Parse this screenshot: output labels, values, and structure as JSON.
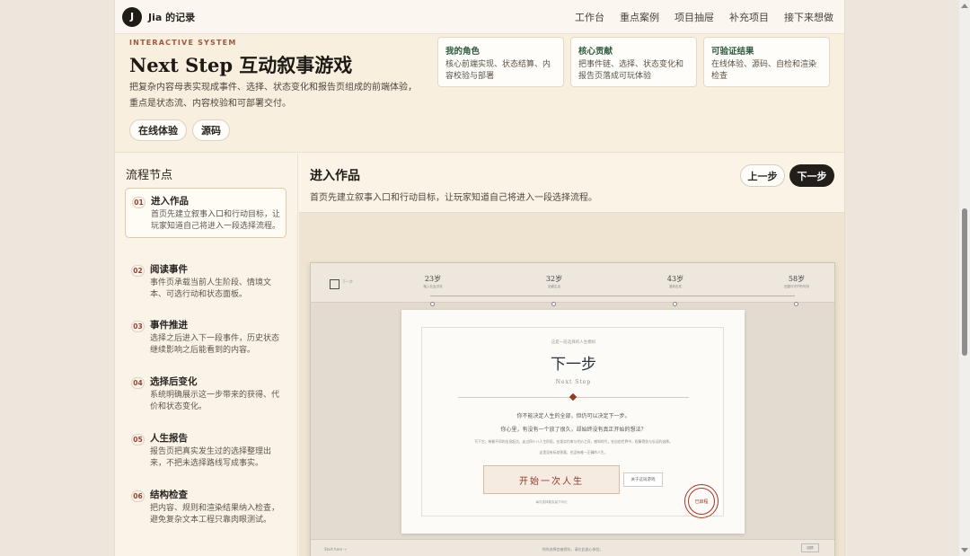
{
  "nav": {
    "avatar_letter": "J",
    "brand": "Jia 的记录",
    "links": [
      "工作台",
      "重点案例",
      "项目抽屉",
      "补充项目",
      "接下来想做"
    ]
  },
  "hero": {
    "eyebrow": "INTERACTIVE SYSTEM",
    "title": "Next Step 互动叙事游戏",
    "description": "把复杂内容母表实现成事件、选择、状态变化和报告页组成的前端体验，重点是状态流、内容校验和可部署交付。",
    "buttons": [
      "在线体验",
      "源码"
    ],
    "cards": [
      {
        "title": "我的角色",
        "body": "核心前端实现、状态结算、内容校验与部署"
      },
      {
        "title": "核心贡献",
        "body": "把事件链、选择、状态变化和报告页落成可玩体验"
      },
      {
        "title": "可验证结果",
        "body": "在线体验、源码、自检和渲染检查"
      }
    ]
  },
  "sidebar": {
    "title": "流程节点",
    "steps": [
      {
        "num": "01",
        "title": "进入作品",
        "desc": "首页先建立叙事入口和行动目标，让玩家知道自己将进入一段选择流程。"
      },
      {
        "num": "02",
        "title": "阅读事件",
        "desc": "事件页承载当前人生阶段、情境文本、可选行动和状态面板。"
      },
      {
        "num": "03",
        "title": "事件推进",
        "desc": "选择之后进入下一段事件，历史状态继续影响之后能看到的内容。"
      },
      {
        "num": "04",
        "title": "选择后变化",
        "desc": "系统明确展示这一步带来的获得、代价和状态变化。"
      },
      {
        "num": "05",
        "title": "人生报告",
        "desc": "报告页把真实发生过的选择整理出来，不把未选择路线写成事实。"
      },
      {
        "num": "06",
        "title": "结构检查",
        "desc": "把内容、规则和渲染结果纳入检查，避免复杂文本工程只靠肉眼测试。"
      }
    ]
  },
  "main": {
    "title": "进入作品",
    "description": "首页先建立叙事入口和行动目标，让玩家知道自己将进入一段选择流程。",
    "prev_label": "上一步",
    "next_label": "下一步"
  },
  "preview": {
    "logo_text": "下一步",
    "timeline": [
      {
        "age": "23岁",
        "label": "踏入社会洪流"
      },
      {
        "age": "32岁",
        "label": "站稳生活"
      },
      {
        "age": "43岁",
        "label": "重新出发"
      },
      {
        "age": "58岁",
        "label": "回望与守护的时刻"
      }
    ],
    "kicker": "这是一段选择的人生模拟",
    "title": "下一步",
    "subtitle": "Next Step",
    "line1": "你不能决定人生的全部，但仍可以决定下一步。",
    "line2": "你心里，有没有一个放了很久，却始终没有真正开始的想法？",
    "line3": "写下它，带着不同的出身起点，走过四十八人生阶段，在现实约束与代价之间，感知时代，在自由世界中，权衡得失与长远的选择。",
    "line4": "这里没有标准答案，也没有唯一正确的人生。",
    "start": "开始一次人生",
    "about": "关于这局游戏",
    "foot": "每次选择都会留下印记",
    "seal": "已启程",
    "bottom_left": "Start here →",
    "bottom_mid": "你的选择会被保存，请在此放心体验。",
    "bottom_btn": "回顾"
  }
}
